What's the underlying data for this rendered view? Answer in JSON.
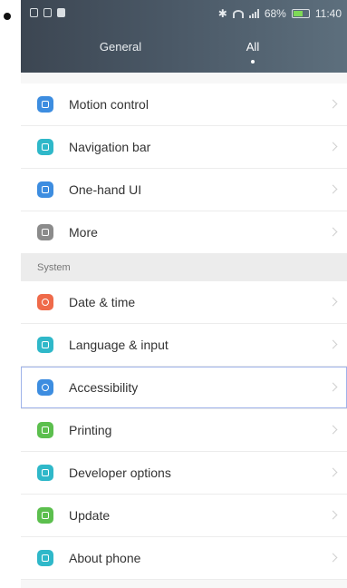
{
  "status_bar": {
    "battery": "68%",
    "time": "11:40",
    "battery_level": 0.68
  },
  "tabs": {
    "general": "General",
    "all": "All"
  },
  "general_items": [
    {
      "label": "Motion control",
      "icon": "hand-icon",
      "color": "#3d8de0"
    },
    {
      "label": "Navigation bar",
      "icon": "navigation-icon",
      "color": "#2fb8c9"
    },
    {
      "label": "One-hand UI",
      "icon": "one-hand-icon",
      "color": "#3d8de0"
    },
    {
      "label": "More",
      "icon": "more-icon",
      "color": "#8b8b8b"
    }
  ],
  "system_section": "System",
  "system_items": [
    {
      "label": "Date & time",
      "icon": "clock-icon",
      "color": "#ef6a4a"
    },
    {
      "label": "Language & input",
      "icon": "keyboard-icon",
      "color": "#2fb8c9"
    },
    {
      "label": "Accessibility",
      "icon": "accessibility-icon",
      "color": "#3d8de0"
    },
    {
      "label": "Printing",
      "icon": "printer-icon",
      "color": "#5cbf4e"
    },
    {
      "label": "Developer options",
      "icon": "developer-icon",
      "color": "#2fb8c9"
    },
    {
      "label": "Update",
      "icon": "update-icon",
      "color": "#5cbf4e"
    },
    {
      "label": "About phone",
      "icon": "phone-icon",
      "color": "#2fb8c9"
    }
  ]
}
